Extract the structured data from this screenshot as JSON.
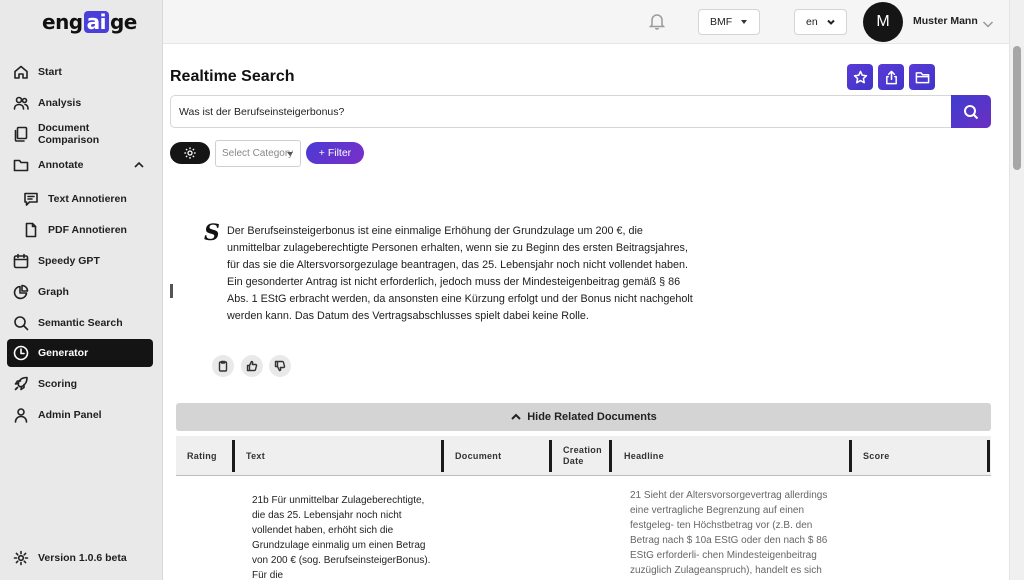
{
  "brand": {
    "logo_prefix": "eng",
    "logo_ai": "ai",
    "logo_suffix": "ge",
    "accent": "#4a3fd8"
  },
  "sidebar": {
    "items": [
      {
        "label": "Start",
        "icon": "home-icon"
      },
      {
        "label": "Analysis",
        "icon": "users-icon"
      },
      {
        "label": "Document Comparison",
        "icon": "documents-icon"
      },
      {
        "label": "Annotate",
        "icon": "folder-icon",
        "expanded": true
      },
      {
        "label": "Text Annotieren",
        "icon": "chat-text-icon",
        "sub": true
      },
      {
        "label": "PDF Annotieren",
        "icon": "file-icon",
        "sub": true
      },
      {
        "label": "Speedy GPT",
        "icon": "calendar-icon"
      },
      {
        "label": "Graph",
        "icon": "pie-chart-icon"
      },
      {
        "label": "Semantic Search",
        "icon": "search-icon"
      },
      {
        "label": "Generator",
        "icon": "clock-icon",
        "active": true
      },
      {
        "label": "Scoring",
        "icon": "rocket-icon"
      },
      {
        "label": "Admin Panel",
        "icon": "user-icon"
      }
    ],
    "version": "Version 1.0.6 beta"
  },
  "header": {
    "bmf_label": "BMF",
    "lang_label": "en",
    "avatar_initial": "M",
    "user_name": "Muster Mann"
  },
  "main": {
    "title": "Realtime Search",
    "search": {
      "value": "Was ist der Berufseinsteigerbonus?"
    },
    "category_placeholder": "Select Category",
    "filter_label": "+ Filter",
    "answer_logo": "S",
    "answer": "Der Berufseinsteigerbonus ist eine einmalige Erhöhung der Grundzulage um 200 €, die unmittelbar zulageberechtigte Personen erhalten, wenn sie zu Beginn des ersten Beitragsjahres, für das sie die Altersvorsorgezulage beantragen, das 25. Lebensjahr noch nicht vollendet haben. Ein gesonderter Antrag ist nicht erforderlich, jedoch muss der Mindesteigenbeitrag gemäß § 86 Abs. 1 EStG erbracht werden, da ansonsten eine Kürzung erfolgt und der Bonus nicht nachgeholt werden kann. Das Datum des Vertragsabschlusses spielt dabei keine Rolle.",
    "hide_related_label": "Hide Related Documents"
  },
  "table": {
    "columns": [
      "Rating",
      "Text",
      "Document",
      "Creation Date",
      "Headline",
      "Score"
    ],
    "rows": [
      {
        "rating": "",
        "text": "21b Für unmittelbar Zulageberechtigte, die das 25. Lebensjahr noch nicht vollendet haben, erhöht sich die Grundzulage einmalig um einen Betrag von 200 € (sog. BerufseinsteigerBonus). Für die",
        "document": "",
        "creation_date": "",
        "headline": "21 Sieht der Altersvorsorgevertrag allerdings eine vertragliche Begrenzung auf einen festgeleg- ten Höchstbetrag vor (z.B. den Betrag nach $ 10a EStG oder den nach $ 86 EStG erforderli- chen Mindesteigenbeitrag zuzüglich Zulageanspruch), handelt es sich bei Zahlungen, die dar- über hinausgehen",
        "score": ""
      }
    ]
  }
}
